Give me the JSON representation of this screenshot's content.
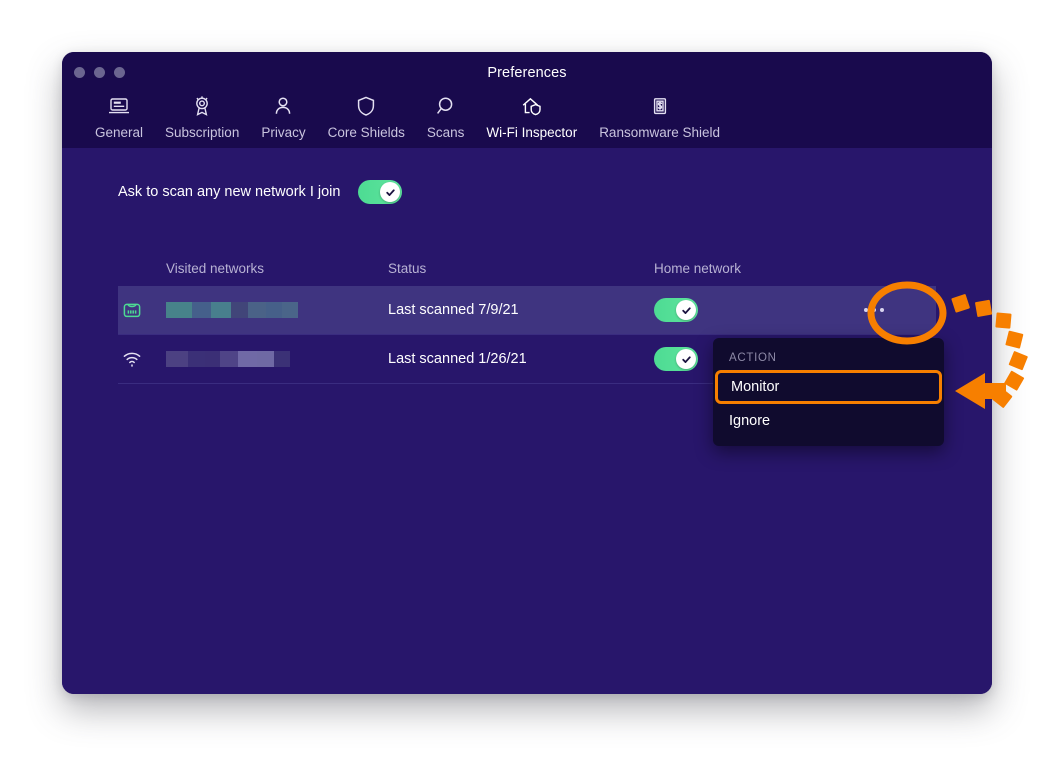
{
  "window": {
    "title": "Preferences",
    "traffic_lights": [
      "close",
      "minimize",
      "zoom"
    ]
  },
  "tabs": [
    {
      "label": "General",
      "icon": "laptop-icon",
      "active": false
    },
    {
      "label": "Subscription",
      "icon": "ribbon-award-icon",
      "active": false
    },
    {
      "label": "Privacy",
      "icon": "person-icon",
      "active": false
    },
    {
      "label": "Core Shields",
      "icon": "shield-icon",
      "active": false
    },
    {
      "label": "Scans",
      "icon": "magnifier-icon",
      "active": false
    },
    {
      "label": "Wi-Fi Inspector",
      "icon": "house-shield-icon",
      "active": true
    },
    {
      "label": "Ransomware Shield",
      "icon": "document-dollar-icon",
      "active": false
    }
  ],
  "settings": {
    "ask_label": "Ask to scan any new network I join",
    "ask_toggle_on": true
  },
  "table": {
    "headers": {
      "network": "Visited networks",
      "status": "Status",
      "home": "Home network",
      "action": ""
    },
    "rows": [
      {
        "icon": "router-icon",
        "name_redacted": true,
        "status": "Last scanned 7/9/21",
        "home_network_on": true,
        "action_icon": "ellipsis-icon",
        "highlighted": true
      },
      {
        "icon": "wifi-icon",
        "name_redacted": true,
        "status": "Last scanned 1/26/21",
        "home_network_on": true,
        "action_icon": "ellipsis-icon",
        "highlighted": false
      }
    ]
  },
  "action_menu": {
    "header": "ACTION",
    "items": [
      {
        "label": "Monitor",
        "selected": true
      },
      {
        "label": "Ignore",
        "selected": false
      }
    ]
  },
  "annotations": {
    "highlight_color": "#f77f00",
    "ellipse_target": "ellipsis-button",
    "arrow_target": "monitor-menu-item"
  },
  "colors": {
    "window_header": "#190a4d",
    "window_body": "#28166b",
    "row_highlight": "#3f3480",
    "tab_accent": "#7a52f4",
    "toggle_on": "#4ddb93",
    "menu_bg": "#100b2e",
    "annotation_orange": "#f77f00"
  }
}
